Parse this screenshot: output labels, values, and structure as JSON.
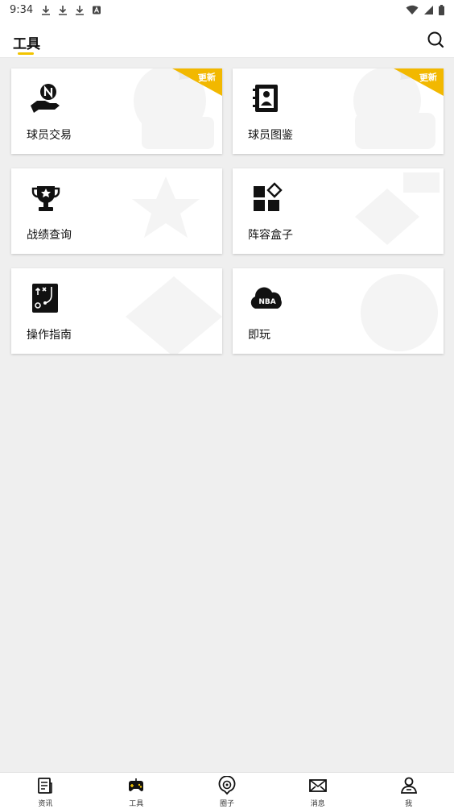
{
  "status_bar": {
    "time": "9:34",
    "notification_icons": [
      "download-icon",
      "download-icon",
      "download-icon",
      "app-notification-icon"
    ],
    "system_icons": [
      "wifi-icon",
      "signal-icon",
      "battery-icon"
    ]
  },
  "header": {
    "title": "工具",
    "search_icon": "search-icon",
    "accent_color": "#f2c400"
  },
  "tools": [
    {
      "label": "球员交易",
      "icon": "hand-n-coin-icon",
      "badge": "更新"
    },
    {
      "label": "球员图鉴",
      "icon": "player-book-icon",
      "badge": "更新"
    },
    {
      "label": "战绩查询",
      "icon": "trophy-icon",
      "badge": ""
    },
    {
      "label": "阵容盒子",
      "icon": "lineup-blocks-icon",
      "badge": ""
    },
    {
      "label": "操作指南",
      "icon": "tactics-board-icon",
      "badge": ""
    },
    {
      "label": "即玩",
      "icon": "nba-cloud-icon",
      "badge": ""
    }
  ],
  "bottom_nav": [
    {
      "label": "资讯",
      "icon": "news-icon"
    },
    {
      "label": "工具",
      "icon": "gamepad-icon",
      "active": true
    },
    {
      "label": "圈子",
      "icon": "circle-pin-icon"
    },
    {
      "label": "消息",
      "icon": "mail-icon"
    },
    {
      "label": "我",
      "icon": "user-icon"
    }
  ]
}
